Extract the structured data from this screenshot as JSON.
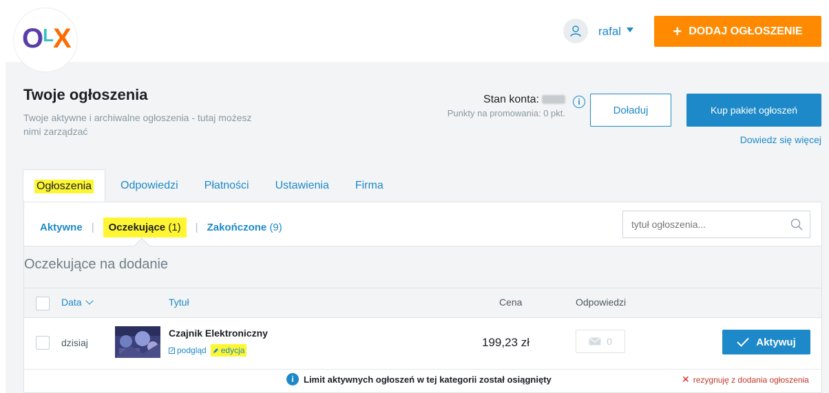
{
  "header": {
    "logo_alt": "OLX",
    "user_name": "rafal",
    "add_button_label": "DODAJ OGŁOSZENIE"
  },
  "page": {
    "title": "Twoje ogłoszenia",
    "subtitle": "Twoje aktywne i archiwalne ogłoszenia - tutaj możesz nimi zarządzać"
  },
  "account": {
    "balance_label": "Stan konta:",
    "points_label": "Punkty na promowania: 0 pkt.",
    "topup_label": "Doładuj",
    "buy_package_label": "Kup pakiet ogłoszeń",
    "learn_more_label": "Dowiedz się więcej"
  },
  "tabs": [
    {
      "label": "Ogłoszenia",
      "active": true
    },
    {
      "label": "Odpowiedzi",
      "active": false
    },
    {
      "label": "Płatności",
      "active": false
    },
    {
      "label": "Ustawienia",
      "active": false
    },
    {
      "label": "Firma",
      "active": false
    }
  ],
  "subtabs": [
    {
      "label": "Aktywne",
      "count": ""
    },
    {
      "label": "Oczekujące",
      "count": "(1)"
    },
    {
      "label": "Zakończone",
      "count": "(9)"
    }
  ],
  "search": {
    "placeholder": "tytuł ogłoszenia..."
  },
  "section": {
    "title": "Oczekujące na dodanie"
  },
  "table": {
    "headers": {
      "date": "Data",
      "title": "Tytuł",
      "price": "Cena",
      "replies": "Odpowiedzi"
    },
    "rows": [
      {
        "date": "dzisiaj",
        "title": "Czajnik Elektroniczny",
        "preview_label": "podgląd",
        "edit_label": "edycja",
        "price": "199,23 zł",
        "replies": "0",
        "activate_label": "Aktywuj"
      }
    ]
  },
  "footer": {
    "limit_message": "Limit aktywnych ogłoszeń w tej kategorii został osiągnięty",
    "resign_label": "rezygnuję z dodania ogłoszenia"
  },
  "colors": {
    "accent_blue": "#1d89c8",
    "orange": "#ff8a00",
    "highlight": "#fff633"
  }
}
